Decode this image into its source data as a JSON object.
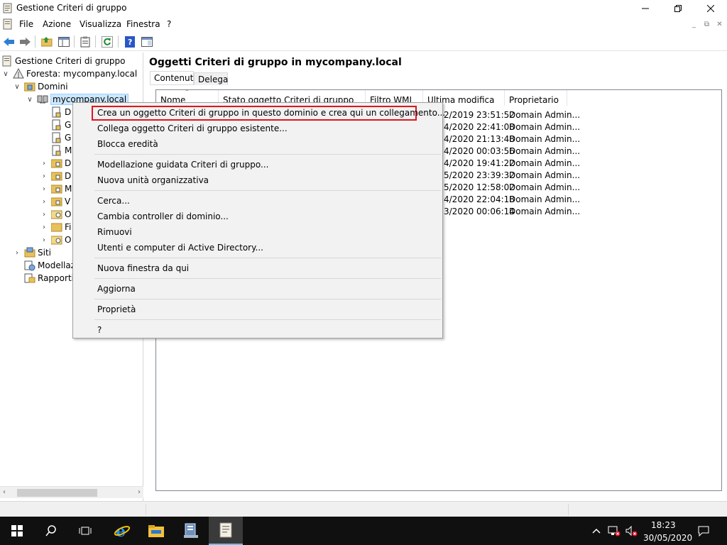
{
  "window": {
    "title": "Gestione Criteri di gruppo"
  },
  "menubar": {
    "items": [
      "File",
      "Azione",
      "Visualizza",
      "Finestra",
      "?"
    ]
  },
  "tree": {
    "root": "Gestione Criteri di gruppo",
    "forest": "Foresta: mycompany.local",
    "domains": "Domini",
    "domain": "mycompany.local",
    "children_partial": [
      "D",
      "G",
      "G",
      "M",
      "D",
      "D",
      "M",
      "V",
      "O",
      "Fi",
      "O"
    ],
    "sites": "Siti",
    "modeling": "Modellaz",
    "reports": "Rapporti"
  },
  "right": {
    "header": "Oggetti Criteri di gruppo in mycompany.local",
    "tabs": [
      "Contenuto",
      "Delega"
    ],
    "columns": [
      "Nome",
      "Stato oggetto Criteri di gruppo",
      "Filtro WMI",
      "Ultima modifica",
      "Proprietario"
    ],
    "rows": [
      {
        "date": "2/2019 23:51:52",
        "owner": "Domain Admin..."
      },
      {
        "date": "4/2020 22:41:08",
        "owner": "Domain Admin..."
      },
      {
        "date": "4/2020 21:13:48",
        "owner": "Domain Admin..."
      },
      {
        "date": "4/2020 00:03:56",
        "owner": "Domain Admin..."
      },
      {
        "date": "4/2020 19:41:22",
        "owner": "Domain Admin..."
      },
      {
        "date": "5/2020 23:39:32",
        "owner": "Domain Admin..."
      },
      {
        "date": "5/2020 12:58:02",
        "owner": "Domain Admin..."
      },
      {
        "date": "4/2020 22:04:18",
        "owner": "Domain Admin..."
      },
      {
        "date": "3/2020 00:06:14",
        "owner": "Domain Admin..."
      }
    ]
  },
  "context_menu": {
    "items": [
      "Crea un oggetto Criteri di gruppo in questo dominio e crea qui un collegamento...",
      "Collega oggetto Criteri di gruppo esistente...",
      "Blocca eredità",
      "Modellazione guidata Criteri di gruppo...",
      "Nuova unità organizzativa",
      "Cerca...",
      "Cambia controller di dominio...",
      "Rimuovi",
      "Utenti e computer di Active Directory...",
      "Nuova finestra da qui",
      "Aggiorna",
      "Proprietà",
      "?"
    ],
    "highlight_color": "#e0141e"
  },
  "taskbar": {
    "time": "18:23",
    "date": "30/05/2020"
  }
}
